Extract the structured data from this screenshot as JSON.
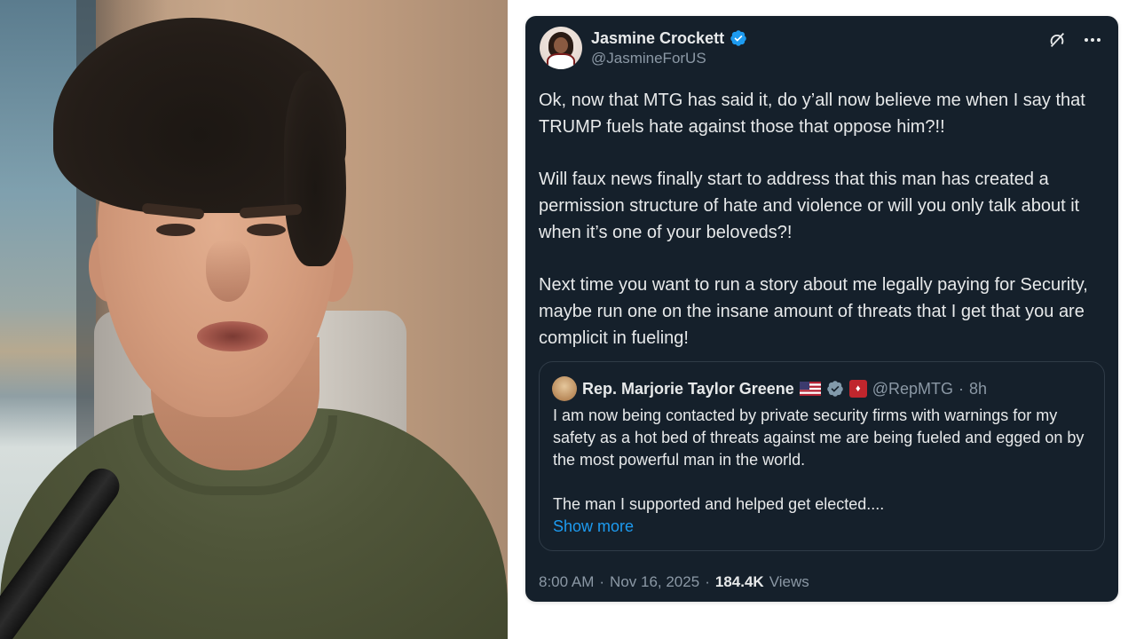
{
  "tweet": {
    "author": {
      "name": "Jasmine Crockett",
      "handle": "@JasmineForUS",
      "verified": true,
      "verified_color": "#1d9bf0"
    },
    "paragraphs": [
      "Ok, now that MTG has said it, do y’all now believe me when I say that TRUMP fuels hate against those that oppose him?!!",
      "Will faux news finally start to address that this man has created a permission structure of hate and violence or will you only talk about it when it’s one of your beloveds?!",
      "Next time you want to run a story about me legally paying for Security, maybe run one on the insane amount of threats that I get that you are complicit in fueling!"
    ],
    "quoted": {
      "name": "Rep. Marjorie Taylor Greene",
      "handle": "@RepMTG",
      "separator": "·",
      "time": "8h",
      "paragraphs": [
        "I am now being contacted by private security firms with warnings for my safety as a hot bed of threats against me are being fueled and egged on by the most powerful man in the world.",
        "The man I supported and helped get elected...."
      ],
      "show_more_label": "Show more"
    },
    "meta": {
      "time": "8:00 AM",
      "separator": "·",
      "date": "Nov 16, 2025",
      "views_count": "184.4K",
      "views_label": "Views"
    },
    "icons": {
      "grok": "grok-icon",
      "more": "more-icon"
    }
  },
  "colors": {
    "card_background": "#15202b",
    "text_primary": "#e7e9ea",
    "text_secondary": "#8b98a5",
    "link": "#1d9bf0"
  }
}
